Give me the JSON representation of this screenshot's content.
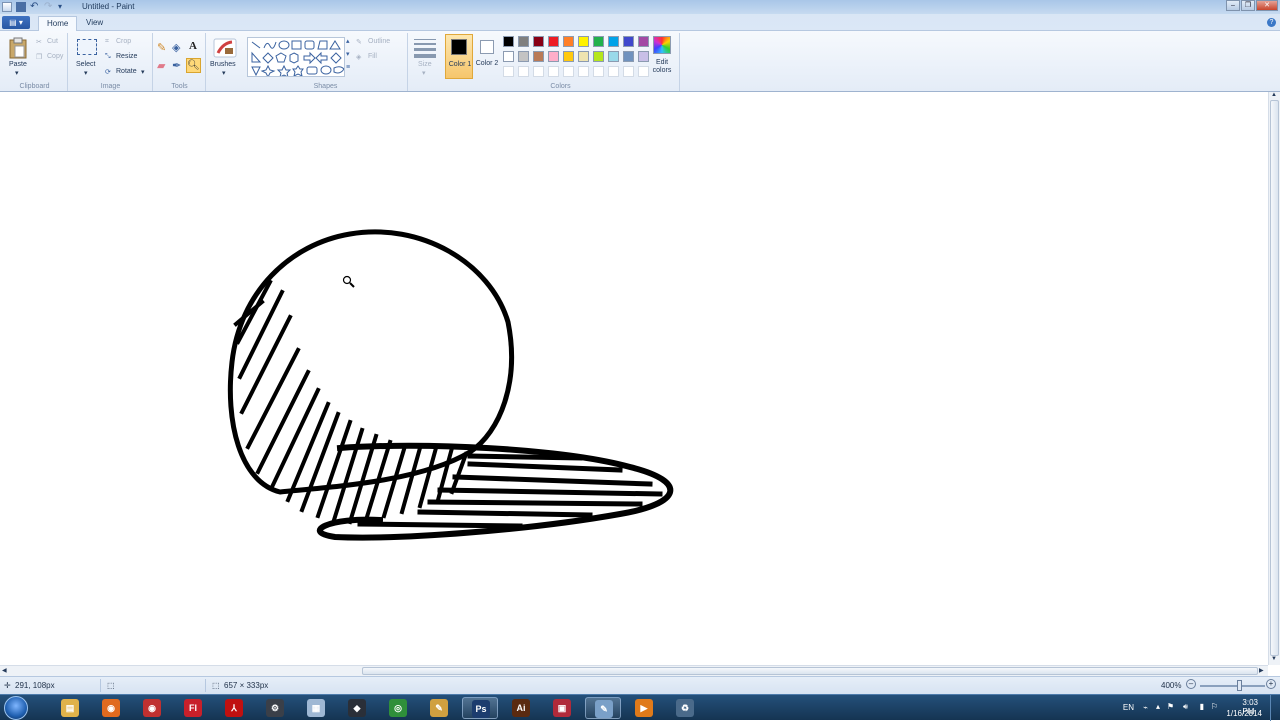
{
  "window": {
    "title": "Untitled - Paint",
    "controls": [
      "minimize",
      "restore",
      "close"
    ]
  },
  "tabs": [
    {
      "label": "Home",
      "active": true
    },
    {
      "label": "View",
      "active": false
    }
  ],
  "ribbon": {
    "clipboard": {
      "paste": "Paste",
      "cut": "Cut",
      "copy": "Copy",
      "group": "Clipboard"
    },
    "image": {
      "select": "Select",
      "crop": "Crop",
      "resize": "Resize",
      "rotate": "Rotate",
      "group": "Image"
    },
    "tools": {
      "group": "Tools"
    },
    "brushes": {
      "label": "Brushes"
    },
    "shapes": {
      "outline": "Outline",
      "fill": "Fill",
      "group": "Shapes"
    },
    "size": {
      "label": "Size"
    },
    "colors": {
      "color1": "Color 1",
      "color2": "Color 2",
      "edit": "Edit colors",
      "group": "Colors",
      "active_color1": "#000000",
      "active_color2": "#ffffff",
      "palette_row1": [
        "#000000",
        "#7f7f7f",
        "#880015",
        "#ed1c24",
        "#ff7f27",
        "#fff200",
        "#22b14c",
        "#00a2e8",
        "#3f48cc",
        "#a349a4"
      ],
      "palette_row2": [
        "#ffffff",
        "#c3c3c3",
        "#b97a57",
        "#ffaec9",
        "#ffc90e",
        "#efe4b0",
        "#b5e61d",
        "#99d9ea",
        "#7092be",
        "#c8bfe7"
      ]
    }
  },
  "status": {
    "cursor_pos": "291, 108px",
    "selection_size": "",
    "image_size": "657 × 333px",
    "zoom": "400%"
  },
  "taskbar": {
    "apps": [
      "Windows Explorer",
      "Firefox",
      "Google Chrome Canary",
      "Flash",
      "Acrobat",
      "Steam",
      "Notepad",
      "Unity",
      "Chrome",
      "Manga Studio",
      "Photoshop",
      "Illustrator",
      "WinRAR",
      "Paint",
      "Media Player",
      "Recycle"
    ],
    "lang": "EN",
    "time": "3:03 PM",
    "date": "1/16/2014"
  }
}
